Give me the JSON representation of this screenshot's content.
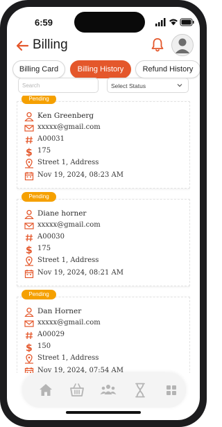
{
  "status_bar": {
    "time": "6:59"
  },
  "header": {
    "title": "Billing"
  },
  "tabs": [
    {
      "label": "Billing Card",
      "active": false
    },
    {
      "label": "Billing History",
      "active": true
    },
    {
      "label": "Refund History",
      "active": false
    }
  ],
  "filters": {
    "search_placeholder": "Search",
    "status_select": "Select Status"
  },
  "records": [
    {
      "status": "Pending",
      "name": "Ken Greenberg",
      "email": "xxxxx@gmail.com",
      "id": "A00031",
      "amount": "175",
      "address": "Street 1, Address",
      "date": "Nov 19, 2024, 08:23 AM"
    },
    {
      "status": "Pending",
      "name": "Diane horner",
      "email": "xxxxx@gmail.com",
      "id": "A00030",
      "amount": "175",
      "address": "Street 1, Address",
      "date": "Nov 19, 2024, 08:21 AM"
    },
    {
      "status": "Pending",
      "name": "Dan Horner",
      "email": "xxxxx@gmail.com",
      "id": "A00029",
      "amount": "150",
      "address": "Street 1, Address",
      "date": "Nov 19, 2024, 07:54 AM"
    }
  ],
  "icons": {
    "person": "person-icon",
    "email": "mail-icon",
    "id": "hash-icon",
    "amount": "dollar-icon",
    "address": "location-pin-icon",
    "date": "calendar-icon"
  },
  "bottom_nav": [
    "home-icon",
    "basket-icon",
    "group-icon",
    "hourglass-icon",
    "grid-icon"
  ],
  "colors": {
    "accent": "#e4572b",
    "badge": "#f5a000",
    "nav_icon": "#b4b4b4"
  }
}
